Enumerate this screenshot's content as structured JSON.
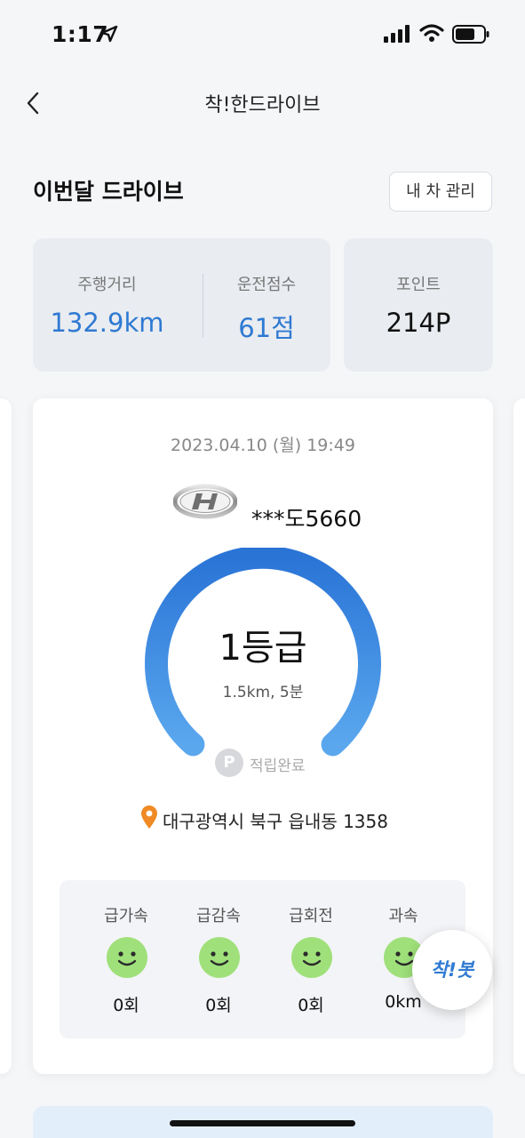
{
  "status_bar": {
    "time": "1:17",
    "icons": [
      "location-arrow-icon",
      "cellular-signal-icon",
      "wifi-icon",
      "battery-icon"
    ]
  },
  "nav": {
    "title": "착!한드라이브",
    "back_icon": "chevron-left-icon"
  },
  "section": {
    "title": "이번달 드라이브",
    "my_car_button": "내 차 관리"
  },
  "stats": {
    "distance_label": "주행거리",
    "distance_value": "132.9km",
    "score_label": "운전점수",
    "score_value": "61점",
    "points_label": "포인트",
    "points_value": "214P"
  },
  "drive": {
    "date": "2023.04.10 (월) 19:49",
    "brand_icon": "hyundai-logo-icon",
    "plate": "***도5660",
    "grade": "1등급",
    "meta": "1.5km, 5분",
    "point_badge": "P",
    "point_status": "적립완료",
    "address": "대구광역시 북구 읍내동 1358",
    "events": [
      {
        "label": "급가속",
        "value": "0회"
      },
      {
        "label": "급감속",
        "value": "0회"
      },
      {
        "label": "급회전",
        "value": "0회"
      },
      {
        "label": "과속",
        "value": "0km"
      }
    ]
  },
  "bot": {
    "label": "착!봇"
  },
  "colors": {
    "accent": "#2f7ad2",
    "gauge_start": "#2a74d6",
    "gauge_end": "#5aa7ee",
    "smile_green": "#9fe07a",
    "card_bg": "#e9ecf1"
  }
}
